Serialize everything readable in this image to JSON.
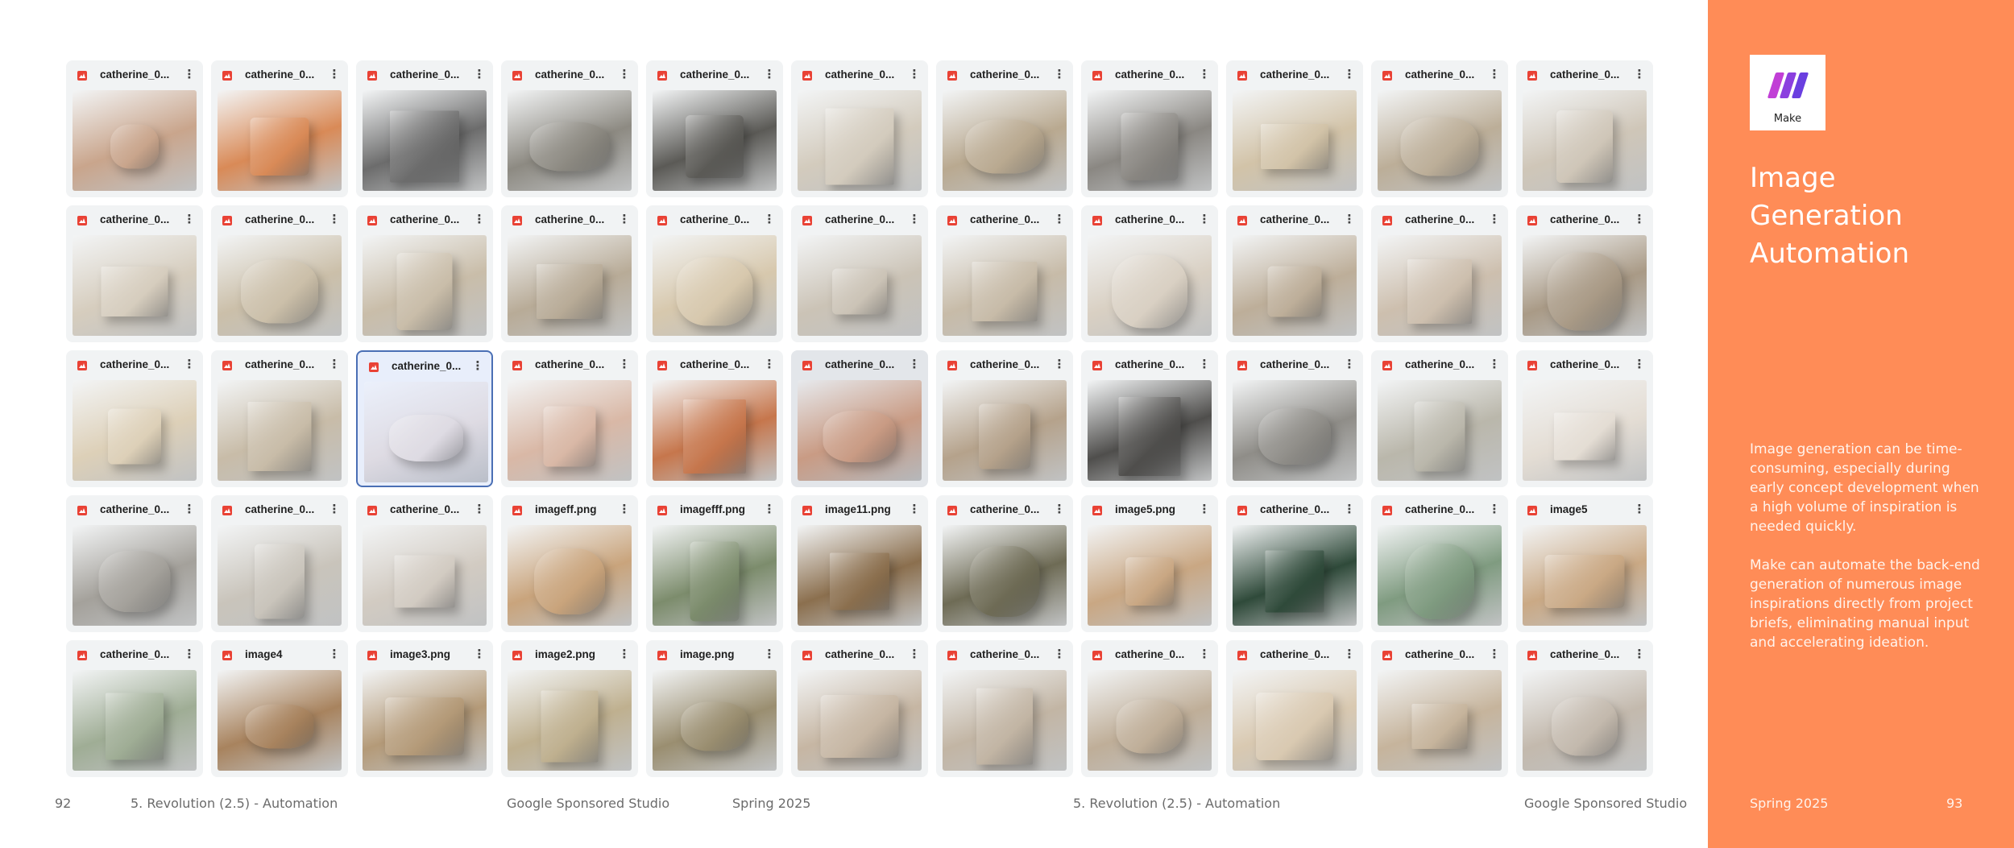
{
  "colors": {
    "accent_panel": "#ff8c57",
    "file_type_icon": "#e94235",
    "selected_border": "#4a6fb5",
    "make_logo_purple": "#7b3fe4"
  },
  "files": [
    {
      "name": "catherine_0...",
      "tone": "#c9a58c"
    },
    {
      "name": "catherine_0...",
      "tone": "#d98a57"
    },
    {
      "name": "catherine_0...",
      "tone": "#6c6c6c"
    },
    {
      "name": "catherine_0...",
      "tone": "#8d8a82"
    },
    {
      "name": "catherine_0...",
      "tone": "#5b5a56"
    },
    {
      "name": "catherine_0...",
      "tone": "#d3cbbd"
    },
    {
      "name": "catherine_0...",
      "tone": "#b9a990"
    },
    {
      "name": "catherine_0...",
      "tone": "#8a8782"
    },
    {
      "name": "catherine_0...",
      "tone": "#d2c3a8"
    },
    {
      "name": "catherine_0...",
      "tone": "#bcae98"
    },
    {
      "name": "catherine_0...",
      "tone": "#cfc6b8"
    },
    {
      "name": "catherine_0...",
      "tone": "#d6cdbe"
    },
    {
      "name": "catherine_0...",
      "tone": "#cbbfa9"
    },
    {
      "name": "catherine_0...",
      "tone": "#c9bda9"
    },
    {
      "name": "catherine_0...",
      "tone": "#b8ab97"
    },
    {
      "name": "catherine_0...",
      "tone": "#d7c8ad"
    },
    {
      "name": "catherine_0...",
      "tone": "#cbc3b6"
    },
    {
      "name": "catherine_0...",
      "tone": "#c7bba8"
    },
    {
      "name": "catherine_0...",
      "tone": "#d9d0c3"
    },
    {
      "name": "catherine_0...",
      "tone": "#bdae99"
    },
    {
      "name": "catherine_0...",
      "tone": "#cdbfae"
    },
    {
      "name": "catherine_0...",
      "tone": "#a99a86"
    },
    {
      "name": "catherine_0...",
      "tone": "#ddd0b8"
    },
    {
      "name": "catherine_0...",
      "tone": "#c8bca8"
    },
    {
      "name": "catherine_0...",
      "tone": "#dedbe3",
      "selected": true
    },
    {
      "name": "catherine_0...",
      "tone": "#d9b8a6"
    },
    {
      "name": "catherine_0...",
      "tone": "#c6764c"
    },
    {
      "name": "catherine_0...",
      "tone": "#c99b84",
      "hover": true
    },
    {
      "name": "catherine_0...",
      "tone": "#b5a28b"
    },
    {
      "name": "catherine_0...",
      "tone": "#4f4e4c"
    },
    {
      "name": "catherine_0...",
      "tone": "#8f8d88"
    },
    {
      "name": "catherine_0...",
      "tone": "#bab7ab"
    },
    {
      "name": "catherine_0...",
      "tone": "#e4ddd4"
    },
    {
      "name": "catherine_0...",
      "tone": "#a4a19b"
    },
    {
      "name": "catherine_0...",
      "tone": "#c9c4bb"
    },
    {
      "name": "catherine_0...",
      "tone": "#d2cbc2"
    },
    {
      "name": "imageff.png",
      "tone": "#c9a47c"
    },
    {
      "name": "imagefff.png",
      "tone": "#7c8c6c"
    },
    {
      "name": "image11.png",
      "tone": "#8b6f4e"
    },
    {
      "name": "catherine_0...",
      "tone": "#6e6b55"
    },
    {
      "name": "image5.png",
      "tone": "#c9a783"
    },
    {
      "name": "catherine_0...",
      "tone": "#2f4a3a"
    },
    {
      "name": "catherine_0...",
      "tone": "#7f9b80"
    },
    {
      "name": "image5",
      "tone": "#caa985"
    },
    {
      "name": "catherine_0...",
      "tone": "#9fad95"
    },
    {
      "name": "image4",
      "tone": "#a8835e"
    },
    {
      "name": "image3.png",
      "tone": "#b49a78"
    },
    {
      "name": "image2.png",
      "tone": "#bfb08f"
    },
    {
      "name": "image.png",
      "tone": "#9a8e70"
    },
    {
      "name": "catherine_0...",
      "tone": "#c6b6a3"
    },
    {
      "name": "catherine_0...",
      "tone": "#c2b5a4"
    },
    {
      "name": "catherine_0...",
      "tone": "#bfae98"
    },
    {
      "name": "catherine_0...",
      "tone": "#d9c9b1"
    },
    {
      "name": "catherine_0...",
      "tone": "#c6b49c"
    },
    {
      "name": "catherine_0...",
      "tone": "#c3b9ad"
    }
  ],
  "footer_left": {
    "page_number_left": "92",
    "section_1": "5. Revolution (2.5) - Automation",
    "studio_1": "Google Sponsored Studio",
    "season_1": "Spring 2025",
    "section_2": "5. Revolution (2.5) - Automation",
    "studio_2": "Google Sponsored Studio"
  },
  "panel": {
    "logo_caption": "Make",
    "title_line1": "Image",
    "title_line2": "Generation",
    "title_line3": "Automation",
    "para1": "Image generation can be time-consuming, especially during early concept development when a high volume of inspiration is needed quickly.",
    "para2": "Make can automate the back-end generation of numerous image inspirations directly from project briefs, eliminating manual input and accelerating ideation.",
    "season": "Spring 2025",
    "page_number_right": "93"
  }
}
